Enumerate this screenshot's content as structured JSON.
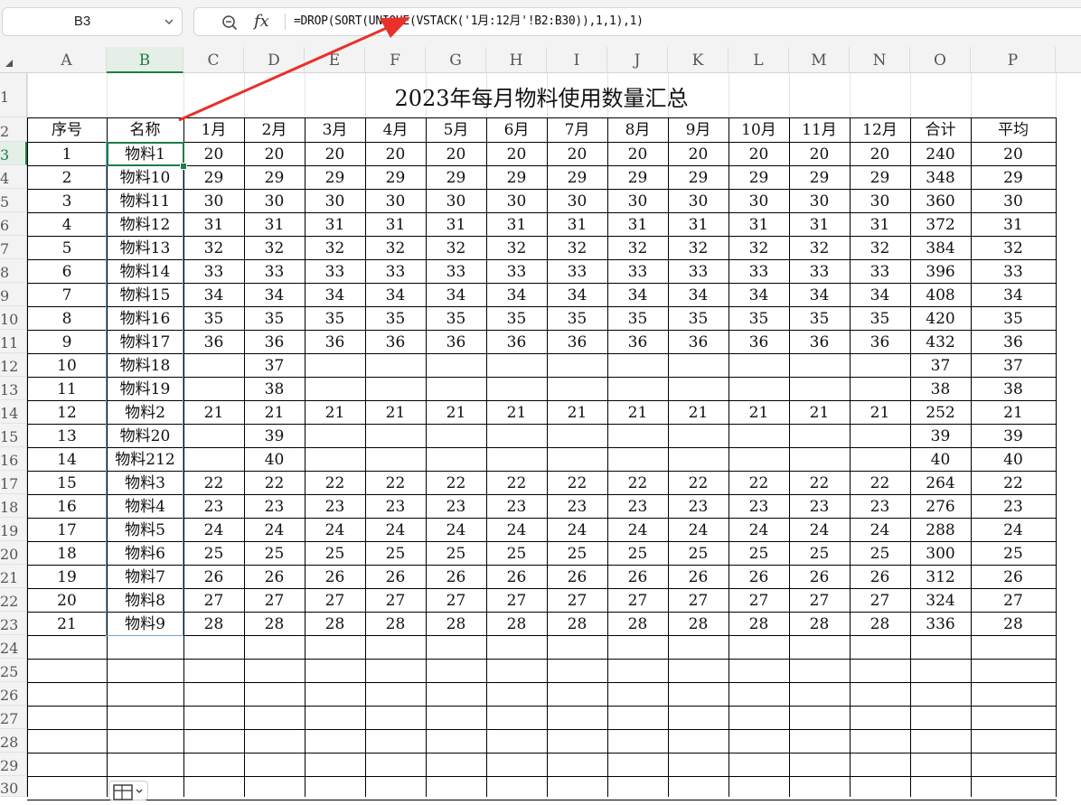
{
  "namebox": {
    "value": "B3"
  },
  "formula_bar": {
    "formula": "=DROP(SORT(UNIQUE(VSTACK('1月:12月'!B2:B30)),1,1),1)"
  },
  "columns": [
    "A",
    "B",
    "C",
    "D",
    "E",
    "F",
    "G",
    "H",
    "I",
    "J",
    "K",
    "L",
    "M",
    "N",
    "O",
    "P"
  ],
  "active_column": "B",
  "active_row": "3",
  "rows": [
    "1",
    "2",
    "3",
    "4",
    "5",
    "6",
    "7",
    "8",
    "9",
    "10",
    "11",
    "12",
    "13",
    "14",
    "15",
    "16",
    "17",
    "18",
    "19",
    "20",
    "21",
    "22",
    "23",
    "24",
    "25",
    "26",
    "27",
    "28",
    "29",
    "30"
  ],
  "sheet": {
    "title": "2023年每月物料使用数量汇总",
    "headers": [
      "序号",
      "名称",
      "1月",
      "2月",
      "3月",
      "4月",
      "5月",
      "6月",
      "7月",
      "8月",
      "9月",
      "10月",
      "11月",
      "12月",
      "合计",
      "平均"
    ],
    "data": [
      [
        "1",
        "物料1",
        "20",
        "20",
        "20",
        "20",
        "20",
        "20",
        "20",
        "20",
        "20",
        "20",
        "20",
        "20",
        "240",
        "20"
      ],
      [
        "2",
        "物料10",
        "29",
        "29",
        "29",
        "29",
        "29",
        "29",
        "29",
        "29",
        "29",
        "29",
        "29",
        "29",
        "348",
        "29"
      ],
      [
        "3",
        "物料11",
        "30",
        "30",
        "30",
        "30",
        "30",
        "30",
        "30",
        "30",
        "30",
        "30",
        "30",
        "30",
        "360",
        "30"
      ],
      [
        "4",
        "物料12",
        "31",
        "31",
        "31",
        "31",
        "31",
        "31",
        "31",
        "31",
        "31",
        "31",
        "31",
        "31",
        "372",
        "31"
      ],
      [
        "5",
        "物料13",
        "32",
        "32",
        "32",
        "32",
        "32",
        "32",
        "32",
        "32",
        "32",
        "32",
        "32",
        "32",
        "384",
        "32"
      ],
      [
        "6",
        "物料14",
        "33",
        "33",
        "33",
        "33",
        "33",
        "33",
        "33",
        "33",
        "33",
        "33",
        "33",
        "33",
        "396",
        "33"
      ],
      [
        "7",
        "物料15",
        "34",
        "34",
        "34",
        "34",
        "34",
        "34",
        "34",
        "34",
        "34",
        "34",
        "34",
        "34",
        "408",
        "34"
      ],
      [
        "8",
        "物料16",
        "35",
        "35",
        "35",
        "35",
        "35",
        "35",
        "35",
        "35",
        "35",
        "35",
        "35",
        "35",
        "420",
        "35"
      ],
      [
        "9",
        "物料17",
        "36",
        "36",
        "36",
        "36",
        "36",
        "36",
        "36",
        "36",
        "36",
        "36",
        "36",
        "36",
        "432",
        "36"
      ],
      [
        "10",
        "物料18",
        "",
        "37",
        "",
        "",
        "",
        "",
        "",
        "",
        "",
        "",
        "",
        "",
        "37",
        "37"
      ],
      [
        "11",
        "物料19",
        "",
        "38",
        "",
        "",
        "",
        "",
        "",
        "",
        "",
        "",
        "",
        "",
        "38",
        "38"
      ],
      [
        "12",
        "物料2",
        "21",
        "21",
        "21",
        "21",
        "21",
        "21",
        "21",
        "21",
        "21",
        "21",
        "21",
        "21",
        "252",
        "21"
      ],
      [
        "13",
        "物料20",
        "",
        "39",
        "",
        "",
        "",
        "",
        "",
        "",
        "",
        "",
        "",
        "",
        "39",
        "39"
      ],
      [
        "14",
        "物料212",
        "",
        "40",
        "",
        "",
        "",
        "",
        "",
        "",
        "",
        "",
        "",
        "",
        "40",
        "40"
      ],
      [
        "15",
        "物料3",
        "22",
        "22",
        "22",
        "22",
        "22",
        "22",
        "22",
        "22",
        "22",
        "22",
        "22",
        "22",
        "264",
        "22"
      ],
      [
        "16",
        "物料4",
        "23",
        "23",
        "23",
        "23",
        "23",
        "23",
        "23",
        "23",
        "23",
        "23",
        "23",
        "23",
        "276",
        "23"
      ],
      [
        "17",
        "物料5",
        "24",
        "24",
        "24",
        "24",
        "24",
        "24",
        "24",
        "24",
        "24",
        "24",
        "24",
        "24",
        "288",
        "24"
      ],
      [
        "18",
        "物料6",
        "25",
        "25",
        "25",
        "25",
        "25",
        "25",
        "25",
        "25",
        "25",
        "25",
        "25",
        "25",
        "300",
        "25"
      ],
      [
        "19",
        "物料7",
        "26",
        "26",
        "26",
        "26",
        "26",
        "26",
        "26",
        "26",
        "26",
        "26",
        "26",
        "26",
        "312",
        "26"
      ],
      [
        "20",
        "物料8",
        "27",
        "27",
        "27",
        "27",
        "27",
        "27",
        "27",
        "27",
        "27",
        "27",
        "27",
        "27",
        "324",
        "27"
      ],
      [
        "21",
        "物料9",
        "28",
        "28",
        "28",
        "28",
        "28",
        "28",
        "28",
        "28",
        "28",
        "28",
        "28",
        "28",
        "336",
        "28"
      ]
    ]
  },
  "colors": {
    "accent_green": "#1e7c45",
    "selection_blue": "#6fa3d8",
    "annotation_arrow": "#e8312a"
  },
  "icons": {
    "zoom": "zoom-out-magnifier-icon",
    "fx": "function-icon",
    "dropdown": "chevron-down-icon",
    "autofill": "autofill-options-icon"
  }
}
